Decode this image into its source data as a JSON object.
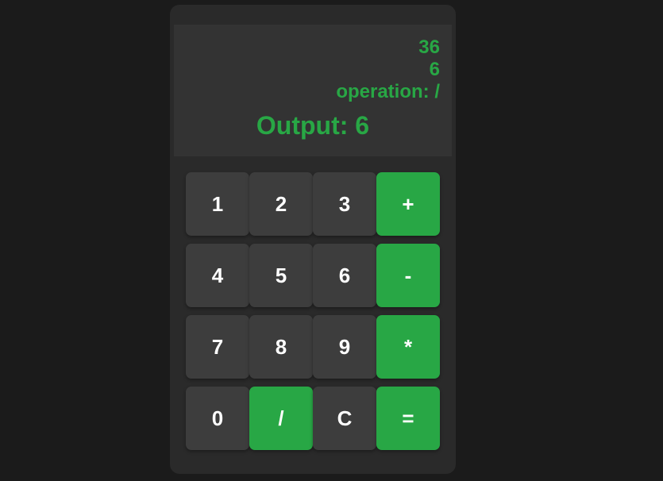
{
  "display": {
    "previous_operand": "36",
    "current_operand": "6",
    "operation_label": "operation: ",
    "operation_value": "/",
    "output_label": "Output: ",
    "output_value": "6"
  },
  "keys": {
    "k1": "1",
    "k2": "2",
    "k3": "3",
    "plus": "+",
    "k4": "4",
    "k5": "5",
    "k6": "6",
    "minus": "-",
    "k7": "7",
    "k8": "8",
    "k9": "9",
    "multiply": "*",
    "k0": "0",
    "divide": "/",
    "clear": "C",
    "equals": "="
  },
  "colors": {
    "accent": "#28a745",
    "background": "#1b1b1b",
    "panel": "#2a2a2a",
    "display": "#333333",
    "key": "#3d3d3d",
    "key_text": "#ffffff"
  }
}
